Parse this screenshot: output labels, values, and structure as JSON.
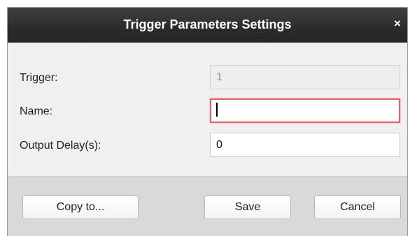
{
  "dialog": {
    "title": "Trigger Parameters Settings",
    "close_label": "×"
  },
  "form": {
    "trigger": {
      "label": "Trigger:",
      "value": "1"
    },
    "name": {
      "label": "Name:",
      "value": ""
    },
    "output_delay": {
      "label": "Output Delay(s):",
      "value": "0"
    }
  },
  "buttons": {
    "copy_to": "Copy to...",
    "save": "Save",
    "cancel": "Cancel"
  },
  "colors": {
    "titlebar": "#2c2c2c",
    "focus_border": "#e06566",
    "body_background": "#f0f0f0",
    "footer_background": "#d9d9d9"
  }
}
